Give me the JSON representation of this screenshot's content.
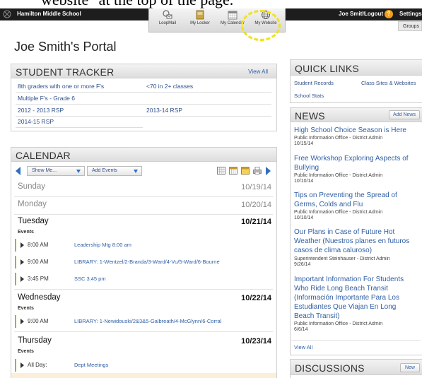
{
  "caption": "website\" at the top of the page.",
  "topbar": {
    "school": "Hamilton Middle School",
    "user": "Joe Smith",
    "logout": "Logout",
    "help": "?",
    "settings": "Settings"
  },
  "apps": [
    {
      "label": "LoopMail",
      "icon": "loopmail-icon"
    },
    {
      "label": "My Locker",
      "icon": "locker-icon"
    },
    {
      "label": "My Calendar",
      "icon": "calendar-icon"
    },
    {
      "label": "My Website",
      "icon": "globe-icon"
    }
  ],
  "groups": "Groups",
  "portal_title": "Joe Smith's Portal",
  "tracker": {
    "title": "STUDENT TRACKER",
    "view_all": "View All",
    "rows": [
      [
        "8th graders with one or more F's",
        "<70 in 2+ classes"
      ],
      [
        "Multiple F's - Grade 6",
        ""
      ],
      [
        "2012 - 2013 RSP",
        "2013-14 RSP"
      ],
      [
        "2014-15 RSP",
        ""
      ]
    ]
  },
  "calendar": {
    "title": "CALENDAR",
    "show_me": "Show Me...",
    "add_events": "Add Events",
    "days": [
      {
        "name": "Sunday",
        "date": "10/19/14"
      },
      {
        "name": "Monday",
        "date": "10/20/14"
      },
      {
        "name": "Tuesday",
        "date": "10/21/14",
        "events_label": "Events",
        "events": [
          {
            "time": "8:00 AM",
            "title": "Leadership Mtg 8:00 am"
          },
          {
            "time": "9:00 AM",
            "title": "LIBRARY: 1-Wentzel/2-Branda/3-Ward/4-Vu/5-Ward/6-Bourne"
          },
          {
            "time": "3:45 PM",
            "title": "SSC 3:45 pm"
          }
        ]
      },
      {
        "name": "Wednesday",
        "date": "10/22/14",
        "events_label": "Events",
        "events": [
          {
            "time": "9:00 AM",
            "title": "LIBRARY: 1-Newidouski/2&3&5-Galbreath/4-McGlynn/6-Corral"
          }
        ]
      },
      {
        "name": "Thursday",
        "date": "10/23/14",
        "events_label": "Events",
        "events": [
          {
            "time": "All Day:",
            "title": "Dept Meetings"
          }
        ]
      }
    ]
  },
  "quick_links": {
    "title": "QUICK LINKS",
    "items": [
      "Student Records",
      "Class Sites & Websites",
      "School Stats"
    ]
  },
  "news": {
    "title": "NEWS",
    "add": "Add News",
    "items": [
      {
        "title": "High School Choice Season is Here",
        "author": "Public Information Office - District Admin",
        "date": "10/15/14"
      },
      {
        "title": "Free Workshop Exploring Aspects of Bullying",
        "author": "Public Information Office - District Admin",
        "date": "10/10/14"
      },
      {
        "title": "Tips on Preventing the Spread of Germs, Colds and Flu",
        "author": "Public Information Office - District Admin",
        "date": "10/10/14"
      },
      {
        "title": "Our Plans in Case of Future Hot Weather (Nuestros planes en futuros casos de clima caluroso)",
        "author": "Superintendent Steinhauser - District Admin",
        "date": "9/26/14"
      },
      {
        "title": "Important Information For Students Who Ride Long Beach Transit (Información Importante Para Los Estudiantes Que Viajan En Long Beach Transit)",
        "author": "Public Information Office - District Admin",
        "date": "6/6/14"
      }
    ],
    "view_all": "View All"
  },
  "discussions": {
    "title": "DISCUSSIONS",
    "new": "New"
  },
  "colors": {
    "link": "#2f5fa5",
    "accent_blue": "#2f6fbf",
    "event_bar": "#9bbd1f",
    "highlight_ring": "#f2e21a",
    "topbar": "#1d1d1d"
  }
}
